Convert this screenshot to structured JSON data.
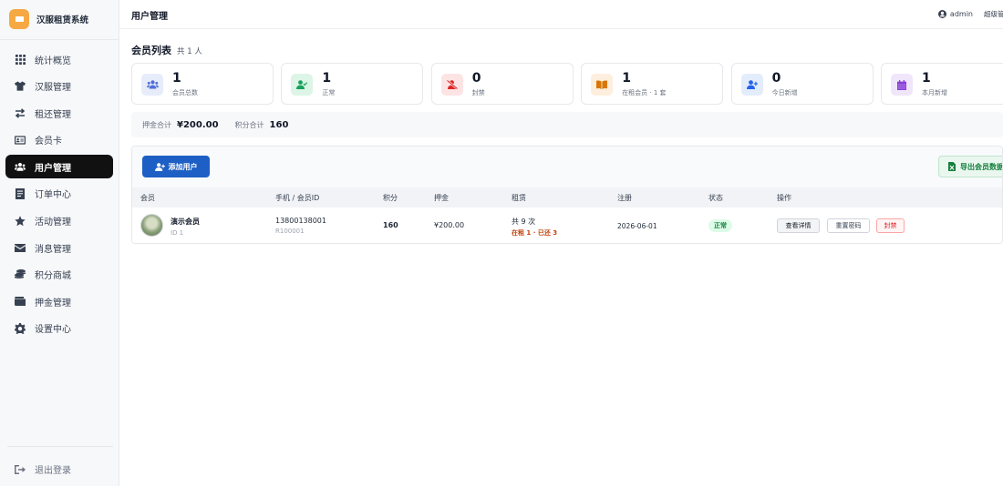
{
  "app": {
    "name": "汉服租赁系统"
  },
  "sidebar": {
    "items": [
      {
        "label": "统计概览",
        "icon": "grid-icon"
      },
      {
        "label": "汉服管理",
        "icon": "shirt-icon"
      },
      {
        "label": "租还管理",
        "icon": "swap-icon"
      },
      {
        "label": "会员卡",
        "icon": "id-card-icon"
      },
      {
        "label": "用户管理",
        "icon": "users-icon",
        "active": true
      },
      {
        "label": "订单中心",
        "icon": "receipt-icon"
      },
      {
        "label": "活动管理",
        "icon": "star-icon"
      },
      {
        "label": "消息管理",
        "icon": "envelope-icon"
      },
      {
        "label": "积分商城",
        "icon": "coins-icon"
      },
      {
        "label": "押金管理",
        "icon": "wallet-icon"
      },
      {
        "label": "设置中心",
        "icon": "gear-icon"
      }
    ],
    "logout_label": "退出登录"
  },
  "header": {
    "title": "用户管理",
    "username": "admin",
    "role": "超级管理员"
  },
  "section": {
    "title": "会员列表",
    "count": "共 1 人"
  },
  "stats": [
    {
      "value": "1",
      "label": "会员总数",
      "icon": "users-icon",
      "bg": "#e7ecfb",
      "fg": "#4f6fd8"
    },
    {
      "value": "1",
      "label": "正常",
      "icon": "user-check-icon",
      "bg": "#ddf5e7",
      "fg": "#16a35a"
    },
    {
      "value": "0",
      "label": "封禁",
      "icon": "user-slash-icon",
      "bg": "#fde4e4",
      "fg": "#dc2626"
    },
    {
      "value": "1",
      "label": "在租会员 · 1 套",
      "icon": "book-open-icon",
      "bg": "#fdeedd",
      "fg": "#d97706"
    },
    {
      "value": "0",
      "label": "今日新增",
      "icon": "user-plus-icon",
      "bg": "#e3ecfb",
      "fg": "#2563eb"
    },
    {
      "value": "1",
      "label": "本月新增",
      "icon": "calendar-icon",
      "bg": "#f0e6fb",
      "fg": "#8b3fd9"
    }
  ],
  "summary": {
    "deposit_label": "押金合计",
    "deposit_value": "¥200.00",
    "points_label": "积分合计",
    "points_value": "160"
  },
  "toolbar": {
    "add_label": "添加用户",
    "export_label": "导出会员数据"
  },
  "table": {
    "headers": [
      "会员",
      "手机 / 会员ID",
      "积分",
      "押金",
      "租赁",
      "注册",
      "状态",
      "操作"
    ],
    "rows": [
      {
        "name": "演示会员",
        "id": "ID 1",
        "phone": "13800138001",
        "member_id": "R100001",
        "points": "160",
        "deposit": "¥200.00",
        "rent_total": "共 9 次",
        "rent_status": "在租 1 · 已还 3",
        "registered": "2026-06-01",
        "status": "正常",
        "actions": {
          "view": "查看详情",
          "reset": "重置密码",
          "ban": "封禁"
        }
      }
    ]
  },
  "colors": {
    "accent": "#1d5fc4",
    "active_nav": "#111111",
    "export": "#15803d",
    "danger": "#dc2626"
  }
}
